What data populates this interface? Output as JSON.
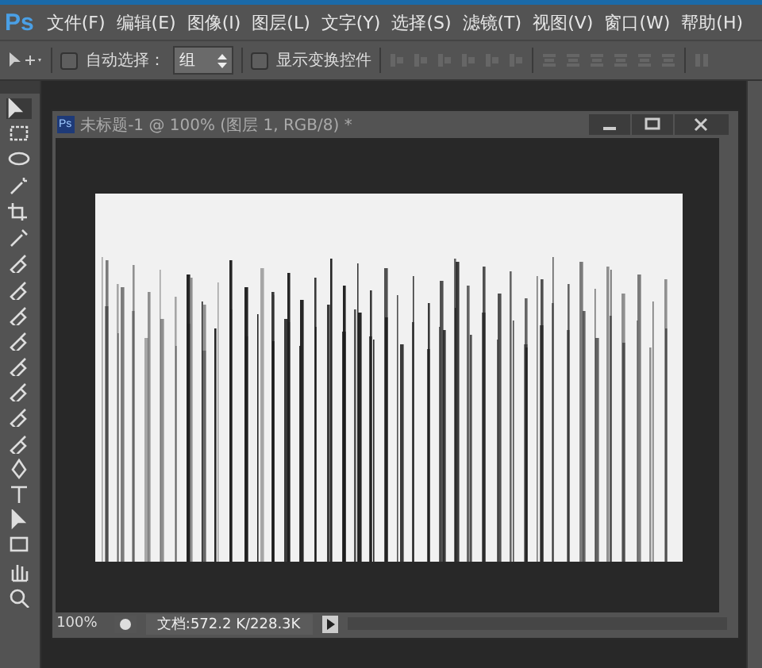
{
  "app": {
    "logo": "Ps"
  },
  "menu": [
    {
      "label": "文件(F)"
    },
    {
      "label": "编辑(E)"
    },
    {
      "label": "图像(I)"
    },
    {
      "label": "图层(L)"
    },
    {
      "label": "文字(Y)"
    },
    {
      "label": "选择(S)"
    },
    {
      "label": "滤镜(T)"
    },
    {
      "label": "视图(V)"
    },
    {
      "label": "窗口(W)"
    },
    {
      "label": "帮助(H)"
    }
  ],
  "options": {
    "auto_select": {
      "label": "自动选择：",
      "checked": false
    },
    "select_value": "组",
    "show_transform": {
      "label": "显示变换控件",
      "checked": false
    }
  },
  "document": {
    "icon": "Ps",
    "title": "未标题-1 @ 100% (图层 1, RGB/8) *",
    "zoom": "100%",
    "doc_info": "文档:572.2 K/228.3K"
  }
}
